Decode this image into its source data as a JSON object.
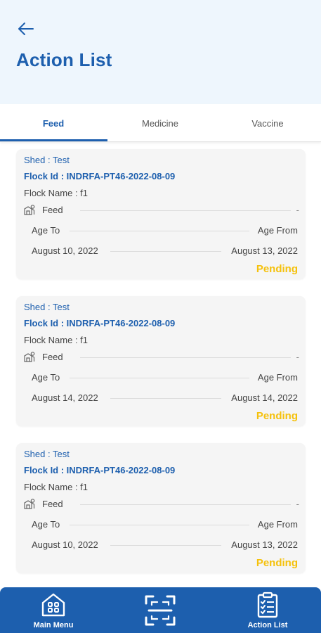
{
  "header": {
    "title": "Action List",
    "back_icon": "arrow-left-icon"
  },
  "tabs": [
    {
      "label": "Feed",
      "active": true
    },
    {
      "label": "Medicine",
      "active": false
    },
    {
      "label": "Vaccine",
      "active": false
    }
  ],
  "cards": [
    {
      "shed": "Shed : Test",
      "flock_id": "Flock Id : INDRFA-PT46-2022-08-09",
      "flock_name": "Flock Name : f1",
      "feed_label": "Feed",
      "feed_value": "-",
      "age_to_label": "Age To",
      "age_from_label": "Age From",
      "date_left": "August 10, 2022",
      "date_right": "August 13, 2022",
      "status": "Pending"
    },
    {
      "shed": "Shed : Test",
      "flock_id": "Flock Id : INDRFA-PT46-2022-08-09",
      "flock_name": "Flock Name : f1",
      "feed_label": "Feed",
      "feed_value": "-",
      "age_to_label": "Age To",
      "age_from_label": "Age From",
      "date_left": "August 14, 2022",
      "date_right": "August 14, 2022",
      "status": "Pending"
    },
    {
      "shed": "Shed : Test",
      "flock_id": "Flock Id : INDRFA-PT46-2022-08-09",
      "flock_name": "Flock Name : f1",
      "feed_label": "Feed",
      "feed_value": "-",
      "age_to_label": "Age To",
      "age_from_label": "Age From",
      "date_left": "August 10, 2022",
      "date_right": "August 13, 2022",
      "status": "Pending"
    }
  ],
  "bottom_nav": [
    {
      "label": "Main Menu",
      "icon": "home-grid-icon"
    },
    {
      "label": "",
      "icon": "scan-icon"
    },
    {
      "label": "Action List",
      "icon": "checklist-icon"
    }
  ],
  "colors": {
    "primary": "#1d5fae",
    "header_bg": "#eef6fd",
    "pending": "#f5c10b",
    "card_bg": "#f5f5f5"
  }
}
